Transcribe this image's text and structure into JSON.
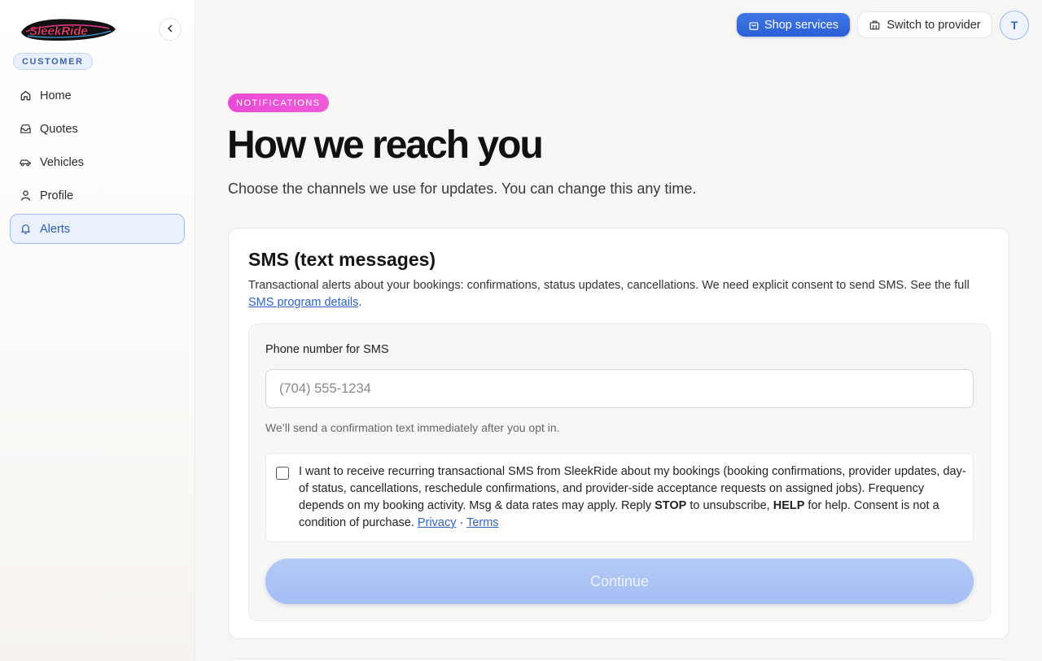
{
  "app": {
    "brand": "SleekRide",
    "role_badge": "CUSTOMER"
  },
  "sidebar": {
    "items": [
      {
        "label": "Home",
        "icon": "home-icon"
      },
      {
        "label": "Quotes",
        "icon": "inbox-icon"
      },
      {
        "label": "Vehicles",
        "icon": "car-icon"
      },
      {
        "label": "Profile",
        "icon": "user-icon"
      },
      {
        "label": "Alerts",
        "icon": "bell-icon",
        "active": true
      }
    ]
  },
  "header": {
    "shop_label": "Shop services",
    "switch_label": "Switch to provider",
    "avatar_initial": "T"
  },
  "page": {
    "eyebrow": "NOTIFICATIONS",
    "title": "How we reach you",
    "subtitle": "Choose the channels we use for updates. You can change this any time."
  },
  "sms_card": {
    "title": "SMS (text messages)",
    "desc_prefix": "Transactional alerts about your bookings: confirmations, status updates, cancellations. We need explicit consent to send SMS. See the full ",
    "desc_link": "SMS program details",
    "desc_suffix": ".",
    "phone_label": "Phone number for SMS",
    "phone_placeholder": "(704) 555-1234",
    "phone_value": "",
    "phone_help": "We’ll send a confirmation text immediately after you opt in.",
    "consent": {
      "checked": false,
      "part1": "I want to receive recurring transactional SMS from SleekRide about my bookings (booking confirmations, provider updates, day-of status, cancellations, reschedule confirmations, and provider-side acceptance requests on assigned jobs). Frequency depends on my booking activity. Msg & data rates may apply. Reply ",
      "stop": "STOP",
      "part2": " to unsubscribe, ",
      "help": "HELP",
      "part3": " for help. Consent is not a condition of purchase. ",
      "privacy": "Privacy",
      "sep": " · ",
      "terms": "Terms"
    },
    "continue_label": "Continue"
  },
  "colors": {
    "accent": "#2b5fd6",
    "active_nav_bg": "#eaf1fd",
    "eyebrow_pink": "#e84bd6",
    "continue_disabled": "#a4bdf3"
  }
}
